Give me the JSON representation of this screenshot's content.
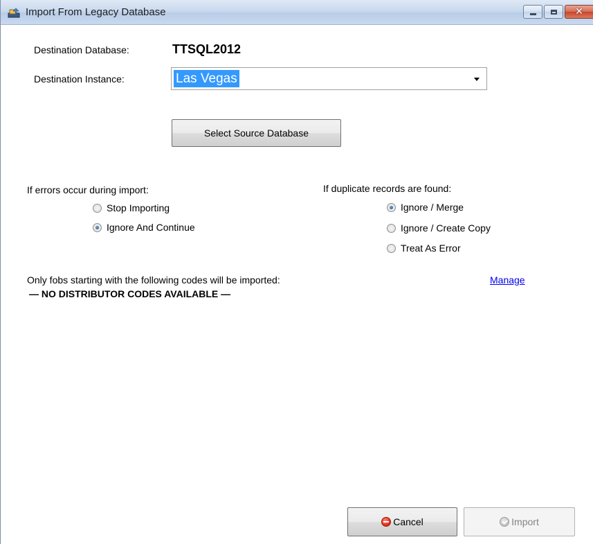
{
  "window": {
    "title": "Import From Legacy Database",
    "icon": "database-import-icon"
  },
  "destination": {
    "database_label": "Destination Database:",
    "database_value": "TTSQL2012",
    "instance_label": "Destination Instance:",
    "instance_value": "Las Vegas"
  },
  "select_source_button": "Select Source Database",
  "errors_group": {
    "heading": "If errors occur during import:",
    "options": [
      {
        "label": "Stop Importing",
        "checked": false
      },
      {
        "label": "Ignore And Continue",
        "checked": true
      }
    ]
  },
  "duplicates_group": {
    "heading": "If duplicate records are found:",
    "options": [
      {
        "label": "Ignore / Merge",
        "checked": true
      },
      {
        "label": "Ignore / Create Copy",
        "checked": false
      },
      {
        "label": "Treat As Error",
        "checked": false
      }
    ]
  },
  "fobs": {
    "text": "Only fobs starting with the following codes will be imported:",
    "manage_link": "Manage",
    "empty_message": "— NO DISTRIBUTOR CODES AVAILABLE —"
  },
  "footer": {
    "cancel_label": "Cancel",
    "import_label": "Import",
    "import_enabled": false
  },
  "colors": {
    "selection": "#3399ff",
    "link": "#0000ee",
    "close_button": "#c7452c"
  }
}
